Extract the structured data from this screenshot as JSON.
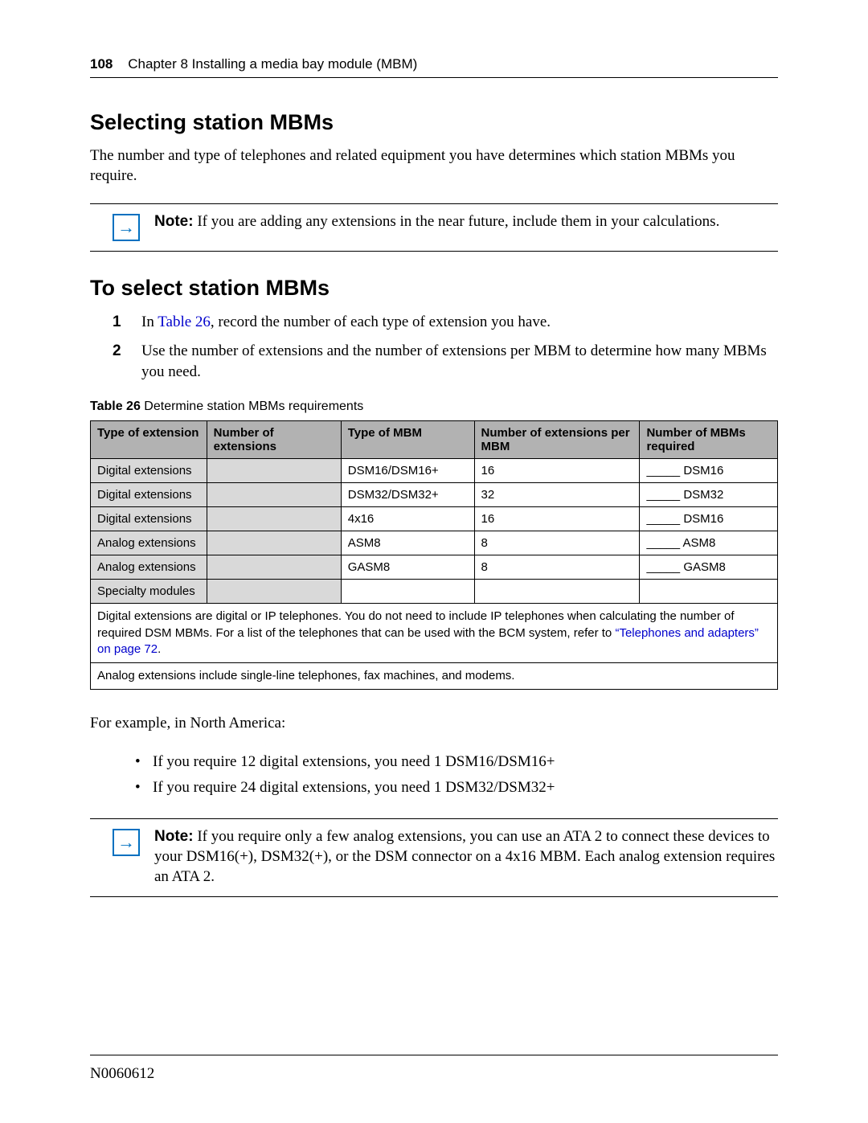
{
  "header": {
    "page_number": "108",
    "chapter": "Chapter 8  Installing a media bay module (MBM)"
  },
  "h1": "Selecting station MBMs",
  "intro": "The number and type of telephones and related equipment you have determines which station MBMs you require.",
  "note1": {
    "label": "Note:",
    "text": " If you are adding any extensions in the near future, include them in your calculations."
  },
  "h2": "To select station MBMs",
  "step1": {
    "num": "1",
    "pre": "In ",
    "link": "Table 26",
    "post": ", record the number of each type of extension you have."
  },
  "step2": {
    "num": "2",
    "text": "Use the number of extensions and the number of extensions per MBM to determine how many MBMs you need."
  },
  "table": {
    "caption_label": "Table 26",
    "caption_text": "   Determine station MBMs requirements",
    "headers": {
      "c1": "Type of extension",
      "c2": "Number of extensions",
      "c3": "Type of MBM",
      "c4": "Number of extensions per MBM",
      "c5": "Number of MBMs required"
    },
    "rows": [
      {
        "c1": "Digital extensions",
        "c2": "",
        "c3": "DSM16/DSM16+",
        "c4": "16",
        "c5": "_____ DSM16"
      },
      {
        "c1": "Digital extensions",
        "c2": "",
        "c3": "DSM32/DSM32+",
        "c4": "32",
        "c5": "_____ DSM32"
      },
      {
        "c1": "Digital extensions",
        "c2": "",
        "c3": "4x16",
        "c4": "16",
        "c5": "_____ DSM16"
      },
      {
        "c1": "Analog extensions",
        "c2": "",
        "c3": "ASM8",
        "c4": "8",
        "c5": "_____ ASM8"
      },
      {
        "c1": "Analog extensions",
        "c2": "",
        "c3": "GASM8",
        "c4": "8",
        "c5": "_____ GASM8"
      },
      {
        "c1": "Specialty modules",
        "c2": "",
        "c3": "",
        "c4": "",
        "c5": ""
      }
    ],
    "footnote1_pre": "Digital extensions are digital or IP telephones. You do not need to include IP telephones when calculating the number of required DSM MBMs. For a list of the telephones that can be used with the BCM system, refer to ",
    "footnote1_link": "“Telephones and adapters” on page 72",
    "footnote1_post": ".",
    "footnote2": "Analog extensions include single-line telephones, fax machines, and modems."
  },
  "example_intro": "For example, in North America:",
  "bullets": [
    "If you require 12 digital extensions, you need 1 DSM16/DSM16+",
    "If you require 24 digital extensions, you need 1 DSM32/DSM32+"
  ],
  "note2": {
    "label": "Note:",
    "text": " If you require only a few analog extensions, you can use an ATA 2 to connect these devices to your DSM16(+), DSM32(+), or the DSM connector on a 4x16 MBM. Each analog extension requires an ATA 2."
  },
  "doc_id": "N0060612"
}
